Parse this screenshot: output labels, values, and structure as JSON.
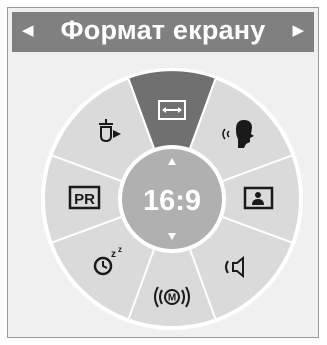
{
  "title": {
    "text": "Формат екрану",
    "prev_icon": "triangle-left",
    "next_icon": "triangle-right"
  },
  "dial": {
    "center_value": "16:9",
    "up_icon": "triangle-up",
    "down_icon": "triangle-down",
    "items": [
      {
        "id": "screen-fit",
        "icon": "double-arrow-box-icon",
        "selected": true
      },
      {
        "id": "clear-voice",
        "icon": "speaking-head-icon",
        "selected": false
      },
      {
        "id": "picture-mode",
        "icon": "picture-frame-icon",
        "selected": false
      },
      {
        "id": "sound-mode",
        "icon": "speaker-icon",
        "selected": false
      },
      {
        "id": "surround",
        "icon": "m-circle-waves-icon",
        "selected": false
      },
      {
        "id": "sleep-timer",
        "icon": "sleep-timer-icon",
        "selected": false
      },
      {
        "id": "program-list",
        "label": "PR",
        "selected": false
      },
      {
        "id": "input-source",
        "icon": "input-arrow-icon",
        "selected": false
      }
    ]
  },
  "colors": {
    "panel_bg": "#f0f0f0",
    "title_bg": "#808080",
    "dial_bg": "#dadada",
    "dial_inner": "#b0b0b0",
    "selected": "#707070",
    "icon": "#1a1a1a"
  }
}
